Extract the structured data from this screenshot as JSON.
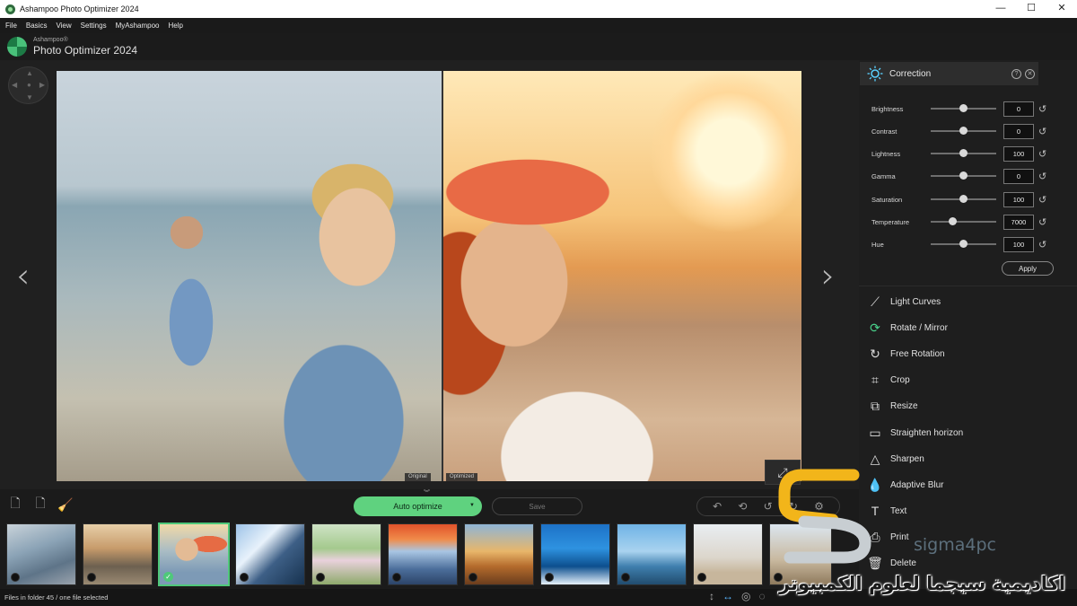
{
  "window": {
    "title": "Ashampoo Photo Optimizer 2024",
    "minimize": "—",
    "maximize": "☐",
    "close": "✕"
  },
  "menu": [
    "File",
    "Basics",
    "View",
    "Settings",
    "MyAshampoo",
    "Help"
  ],
  "brand": {
    "top": "Ashampoo®",
    "main": "Photo Optimizer 2024"
  },
  "compare": {
    "left": "Original",
    "right": "Optimized"
  },
  "toolbar": {
    "auto_optimize": "Auto optimize",
    "save": "Save"
  },
  "correction": {
    "title": "Correction",
    "apply": "Apply",
    "sliders": [
      {
        "label": "Brightness",
        "value": "0",
        "level": 0.5
      },
      {
        "label": "Contrast",
        "value": "0",
        "level": 0.5
      },
      {
        "label": "Lightness",
        "value": "100",
        "level": 0.5
      },
      {
        "label": "Gamma",
        "value": "0",
        "level": 0.5
      },
      {
        "label": "Saturation",
        "value": "100",
        "level": 0.5
      },
      {
        "label": "Temperature",
        "value": "7000",
        "level": 0.33
      },
      {
        "label": "Hue",
        "value": "100",
        "level": 0.5
      }
    ]
  },
  "tools": [
    {
      "label": "Light Curves",
      "icon": "curves-icon"
    },
    {
      "label": "Rotate / Mirror",
      "icon": "rotate-icon"
    },
    {
      "label": "Free Rotation",
      "icon": "free-rotation-icon"
    },
    {
      "label": "Crop",
      "icon": "crop-icon"
    },
    {
      "label": "Resize",
      "icon": "resize-icon"
    },
    {
      "label": "Straighten horizon",
      "icon": "horizon-icon"
    },
    {
      "label": "Sharpen",
      "icon": "sharpen-icon"
    },
    {
      "label": "Adaptive Blur",
      "icon": "blur-icon"
    },
    {
      "label": "Text",
      "icon": "text-icon"
    },
    {
      "label": "Print",
      "icon": "print-icon"
    },
    {
      "label": "Delete",
      "icon": "delete-icon"
    }
  ],
  "status": {
    "text": "Files in folder 45 / one file selected"
  },
  "watermark": {
    "en": "sigma4pc",
    "ar": "اكاديمية سيجما لعلوم الكمبيوتر"
  },
  "thumbnails": [
    {
      "name": "frozen-tree",
      "selected": false
    },
    {
      "name": "hikers",
      "selected": false
    },
    {
      "name": "beach-family",
      "selected": true
    },
    {
      "name": "skyscraper",
      "selected": false
    },
    {
      "name": "wedding",
      "selected": false
    },
    {
      "name": "fuji-lake",
      "selected": false
    },
    {
      "name": "city-sunset",
      "selected": false
    },
    {
      "name": "surfer",
      "selected": false
    },
    {
      "name": "beach-jump",
      "selected": false
    },
    {
      "name": "beach-kid",
      "selected": false
    },
    {
      "name": "partial",
      "selected": false
    }
  ]
}
